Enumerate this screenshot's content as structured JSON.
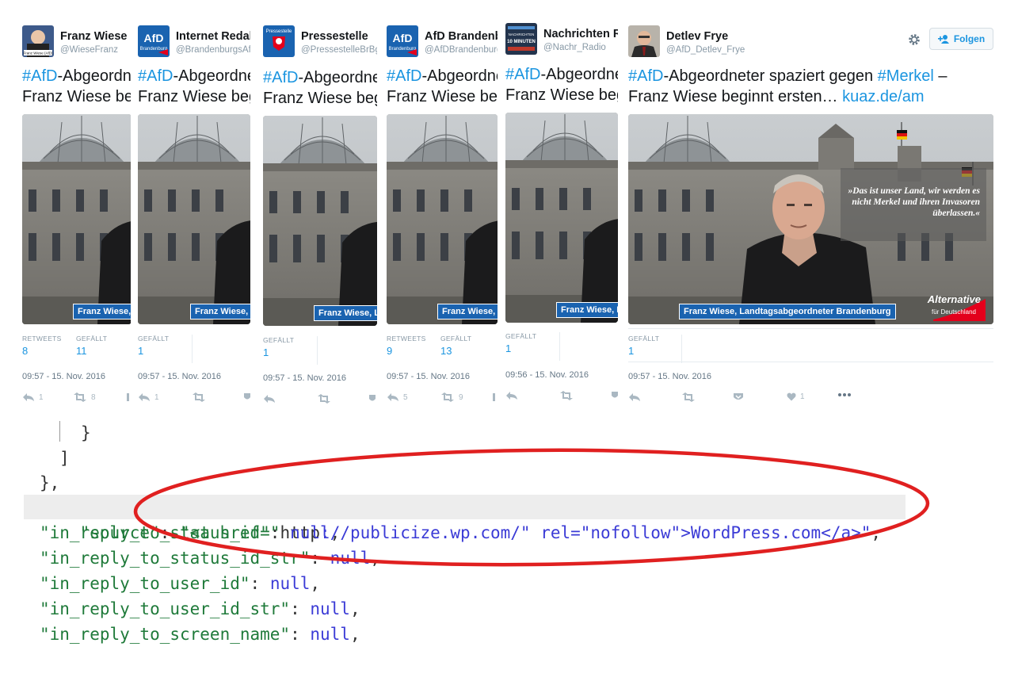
{
  "tweets": [
    {
      "name": "Franz Wiese",
      "handle": "@WieseFranz",
      "text_tag": "#AfD",
      "text_rest": "-Abgeordneter spaziert gegen",
      "line2": "Franz Wiese beginnt ersten…",
      "caption": "Franz Wiese, Landtagsabgeordneter Brandenburg",
      "stats": [
        {
          "label": "RETWEETS",
          "value": "8"
        },
        {
          "label": "GEFÄLLT",
          "value": "11"
        }
      ],
      "time": "09:57 - 15. Nov. 2016",
      "reply_count": "1",
      "retweet_count": "8"
    },
    {
      "name": "Internet Redaktion",
      "handle": "@BrandenburgsAfD",
      "text_tag": "#AfD",
      "text_rest": "-Abgeordneter spaziert gegen",
      "line2": "Franz Wiese beginnt ersten…",
      "caption": "Franz Wiese, Landtagsabgeordneter Brandenburg",
      "stats": [
        {
          "label": "GEFÄLLT",
          "value": "1"
        }
      ],
      "time": "09:57 - 15. Nov. 2016",
      "reply_count": "1",
      "retweet_count": ""
    },
    {
      "name": "Pressestelle",
      "handle": "@PressestelleBrBg",
      "text_tag": "#AfD",
      "text_rest": "-Abgeordneter spaziert gegen",
      "line2": "Franz Wiese beginnt ersten…",
      "caption": "Franz Wiese, Landtagsabgeordneter Brandenburg",
      "stats": [
        {
          "label": "GEFÄLLT",
          "value": "1"
        }
      ],
      "time": "09:57 - 15. Nov. 2016",
      "reply_count": "",
      "retweet_count": ""
    },
    {
      "name": "AfD Brandenburg",
      "handle": "@AfDBrandenburg",
      "text_tag": "#AfD",
      "text_rest": "-Abgeordneter spaziert gegen",
      "line2": "Franz Wiese beginnt ersten…",
      "caption": "Franz Wiese, Landtagsabgeordneter Brandenburg",
      "stats": [
        {
          "label": "RETWEETS",
          "value": "9"
        },
        {
          "label": "GEFÄLLT",
          "value": "13"
        }
      ],
      "time": "09:57 - 15. Nov. 2016",
      "reply_count": "5",
      "retweet_count": "9"
    },
    {
      "name": "Nachrichten Radio",
      "handle": "@Nachr_Radio",
      "text_tag": "#AfD",
      "text_rest": "-Abgeordneter spaziert gegen",
      "line2": "Franz Wiese beginnt ersten…",
      "caption": "Franz Wiese, Landtagsabgeordneter Brandenburg",
      "stats": [
        {
          "label": "GEFÄLLT",
          "value": "1"
        }
      ],
      "time": "09:56 - 15. Nov. 2016",
      "reply_count": "",
      "retweet_count": ""
    },
    {
      "name": "Detlev Frye",
      "handle": "@AfD_Detlev_Frye",
      "text_tag": "#AfD",
      "text_rest": "-Abgeordneter spaziert gegen ",
      "text_tag2": "#Merkel",
      "text_end": " –",
      "line2": "Franz Wiese beginnt ersten…",
      "link": "kuaz.de/am",
      "caption": "Franz Wiese, Landtagsabgeordneter Brandenburg",
      "stats": [
        {
          "label": "GEFÄLLT",
          "value": "1"
        }
      ],
      "time": "09:57 - 15. Nov. 2016",
      "reply_count": "",
      "retweet_count": "",
      "like_count": "1",
      "quote": "»Das ist unser Land, wir werden es nicht Merkel und ihren Invasoren überlassen.«",
      "brand": "Alternative",
      "brand_sub": "für Deutschland",
      "follow_label": "Folgen"
    }
  ],
  "avatar_texts": {
    "afd": "AfD",
    "afd_sub": "Brandenburg",
    "presse": "Pressestelle",
    "news": "NACHRICHTEN",
    "news2": "10 MINUTEN",
    "franz_avatar": "Franz Wiese (AfD)"
  },
  "code": {
    "brace_close": "}",
    "bracket_close": "]",
    "obj_close": "},",
    "lines": [
      {
        "key": "\"source\"",
        "sep": ": ",
        "val_pre": "\"<a href=\"",
        "val_mid": "http",
        "val_post": "://publicize.wp.com/\" rel=\"nofollow\">WordPress.com</a>\"",
        "end": ","
      },
      {
        "key": "\"in_reply_to_status_id\"",
        "sep": ": ",
        "val": "null",
        "end": ","
      },
      {
        "key": "\"in_reply_to_status_id_str\"",
        "sep": ": ",
        "val": "null",
        "end": ","
      },
      {
        "key": "\"in_reply_to_user_id\"",
        "sep": ": ",
        "val": "null",
        "end": ","
      },
      {
        "key": "\"in_reply_to_user_id_str\"",
        "sep": ": ",
        "val": "null",
        "end": ","
      },
      {
        "key": "\"in_reply_to_screen_name\"",
        "sep": ": ",
        "val": "null",
        "end": ","
      }
    ]
  },
  "colors": {
    "link": "#1b95e0",
    "annotation": "#e02020",
    "afd_blue": "#1a63b0"
  }
}
